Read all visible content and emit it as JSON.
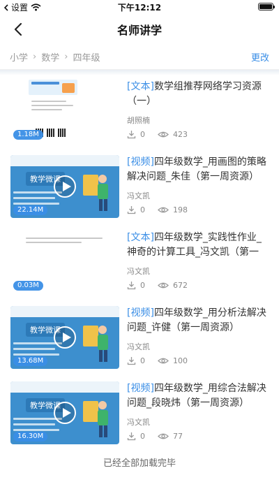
{
  "status_bar": {
    "back_app": "设置",
    "time": "下午12:12",
    "battery_level": 1.0
  },
  "nav": {
    "title": "名师讲学"
  },
  "breadcrumb": {
    "items": [
      "小学",
      "数学",
      "四年级"
    ],
    "change_label": "更改"
  },
  "resources": [
    {
      "kind": "doc",
      "tag": "[文本]",
      "title": "数学组推荐网络学习资源（一）",
      "author": "胡照楠",
      "likes": "0",
      "views": "423",
      "size": "1.18M"
    },
    {
      "kind": "video",
      "tag": "[视频]",
      "title": "四年级数学_用画图的策略解决问题_朱佳（第一周资源）",
      "author": "冯文凯",
      "likes": "0",
      "views": "198",
      "size": "22.14M",
      "thumb_title": "教学微课"
    },
    {
      "kind": "doc",
      "tag": "[文本]",
      "title": "四年级数学_实践性作业_神奇的计算工具_冯文凯（第一周资",
      "author": "冯文凯",
      "likes": "0",
      "views": "672",
      "size": "0.03M"
    },
    {
      "kind": "video",
      "tag": "[视频]",
      "title": "四年级数学_用分析法解决问题_许健（第一周资源）",
      "author": "冯文凯",
      "likes": "0",
      "views": "100",
      "size": "13.68M",
      "thumb_title": "教学微课"
    },
    {
      "kind": "video",
      "tag": "[视频]",
      "title": "四年级数学_用综合法解决问题_段晓炜（第一周资源）",
      "author": "冯文凯",
      "likes": "0",
      "views": "77",
      "size": "16.30M",
      "thumb_title": "教学微课"
    }
  ],
  "footer": {
    "text": "已经全部加载完毕"
  },
  "colors": {
    "accent": "#3a8ee6",
    "video_bg": "#3d8fce"
  }
}
